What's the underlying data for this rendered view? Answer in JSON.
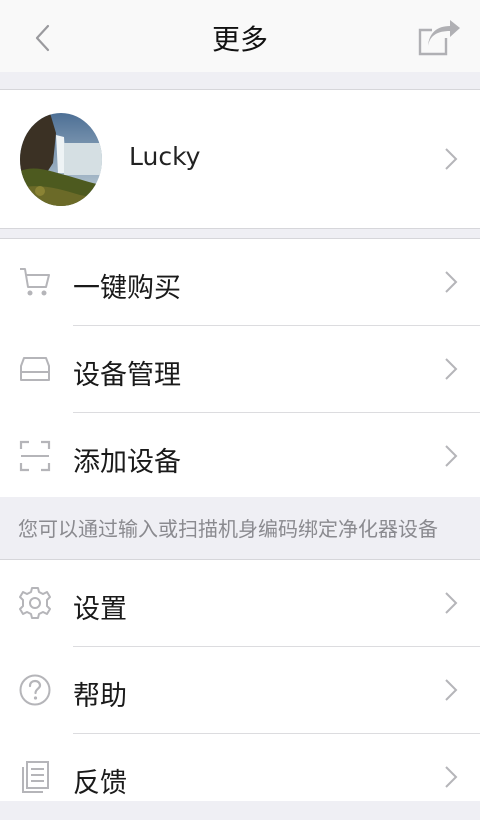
{
  "header": {
    "title": "更多"
  },
  "profile": {
    "name": "Lucky"
  },
  "group1": [
    {
      "label": "一键购买",
      "icon": "cart-icon"
    },
    {
      "label": "设备管理",
      "icon": "device-icon"
    },
    {
      "label": "添加设备",
      "icon": "scan-icon"
    }
  ],
  "hint": "您可以通过输入或扫描机身编码绑定净化器设备",
  "group2": [
    {
      "label": "设置",
      "icon": "gear-icon"
    },
    {
      "label": "帮助",
      "icon": "help-icon"
    },
    {
      "label": "反馈",
      "icon": "feedback-icon"
    }
  ],
  "colors": {
    "background": "#efeff4",
    "icon_gray": "#b5b5b9",
    "hint_text": "#8a8a8f"
  }
}
